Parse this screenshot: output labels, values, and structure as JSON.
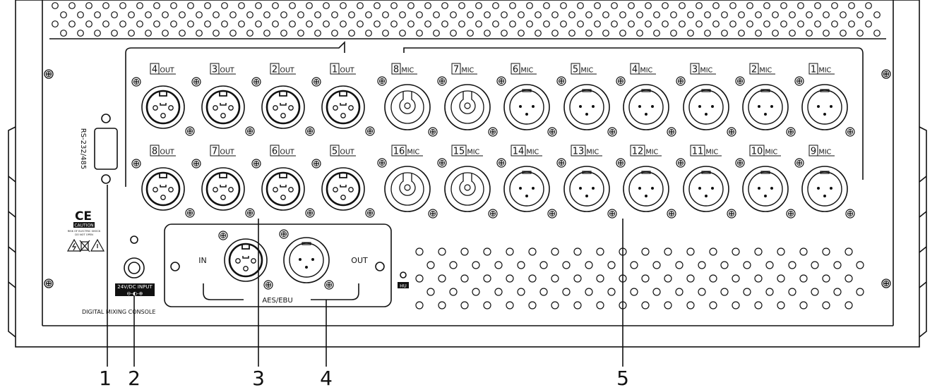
{
  "console_name": "DIGITAL MIXING CONSOLE",
  "rs_label": "RS-232/485",
  "power_label": "24V/DC INPUT",
  "power_polarity": "⊖-◐-⊕",
  "ce_mark": "CE",
  "caution": "CAUTION",
  "caution_line1": "RISK OF ELECTRIC SHOCK",
  "caution_line2": "DO NOT OPEN",
  "aes_label": "AES/EBU",
  "aes_in": "IN",
  "aes_out": "OUT",
  "hu_label": "HU",
  "outputs_top": [
    {
      "num": "4",
      "tag": "OUT"
    },
    {
      "num": "3",
      "tag": "OUT"
    },
    {
      "num": "2",
      "tag": "OUT"
    },
    {
      "num": "1",
      "tag": "OUT"
    }
  ],
  "outputs_bottom": [
    {
      "num": "8",
      "tag": "OUT"
    },
    {
      "num": "7",
      "tag": "OUT"
    },
    {
      "num": "6",
      "tag": "OUT"
    },
    {
      "num": "5",
      "tag": "OUT"
    }
  ],
  "mics_top": [
    {
      "num": "8",
      "tag": "MIC",
      "combo": true
    },
    {
      "num": "7",
      "tag": "MIC",
      "combo": true
    },
    {
      "num": "6",
      "tag": "MIC",
      "combo": false
    },
    {
      "num": "5",
      "tag": "MIC",
      "combo": false
    },
    {
      "num": "4",
      "tag": "MIC",
      "combo": false
    },
    {
      "num": "3",
      "tag": "MIC",
      "combo": false
    },
    {
      "num": "2",
      "tag": "MIC",
      "combo": false
    },
    {
      "num": "1",
      "tag": "MIC",
      "combo": false
    }
  ],
  "mics_bottom": [
    {
      "num": "16",
      "tag": "MIC",
      "combo": true
    },
    {
      "num": "15",
      "tag": "MIC",
      "combo": true
    },
    {
      "num": "14",
      "tag": "MIC",
      "combo": false
    },
    {
      "num": "13",
      "tag": "MIC",
      "combo": false
    },
    {
      "num": "12",
      "tag": "MIC",
      "combo": false
    },
    {
      "num": "11",
      "tag": "MIC",
      "combo": false
    },
    {
      "num": "10",
      "tag": "MIC",
      "combo": false
    },
    {
      "num": "9",
      "tag": "MIC",
      "combo": false
    }
  ],
  "callouts": [
    "1",
    "2",
    "3",
    "4",
    "5"
  ],
  "colors": {
    "stroke": "#111111",
    "panel": "#ffffff"
  }
}
